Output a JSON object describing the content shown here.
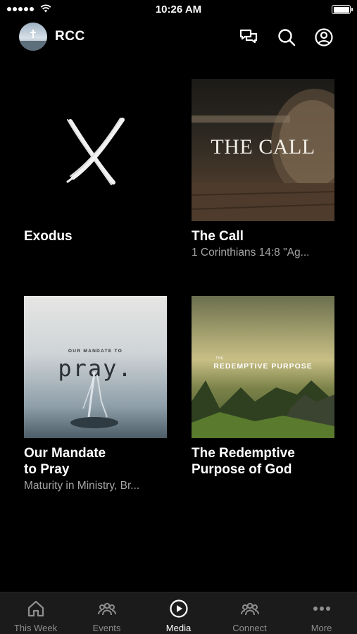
{
  "status_bar": {
    "time": "10:26 AM"
  },
  "header": {
    "title": "RCC",
    "icons": [
      "chat-icon",
      "search-icon",
      "account-icon"
    ]
  },
  "media": {
    "items": [
      {
        "title": "Exodus",
        "subtitle": ""
      },
      {
        "title": "The Call",
        "subtitle": "1 Corinthians 14:8 \"Ag...",
        "art_text": "THE CALL"
      },
      {
        "title": "Our Mandate\nto Pray",
        "subtitle": "Maturity in Ministry, Br...",
        "art_kicker": "OUR MANDATE TO",
        "art_word": "pray."
      },
      {
        "title": "The Redemptive\nPurpose of God",
        "subtitle": "",
        "art_small": "THE",
        "art_text": "REDEMPTIVE PURPOSE"
      }
    ]
  },
  "tabbar": {
    "tabs": [
      {
        "label": "This Week",
        "icon": "home-icon",
        "active": false
      },
      {
        "label": "Events",
        "icon": "people-icon",
        "active": false
      },
      {
        "label": "Media",
        "icon": "play-circle-icon",
        "active": true
      },
      {
        "label": "Connect",
        "icon": "group-icon",
        "active": false
      },
      {
        "label": "More",
        "icon": "more-dots-icon",
        "active": false
      }
    ]
  },
  "colors": {
    "background": "#000000",
    "tabbar": "#1b1b1b",
    "text": "#ffffff",
    "secondary_text": "#a4a4a4",
    "inactive_tab": "#8e8e8e"
  }
}
